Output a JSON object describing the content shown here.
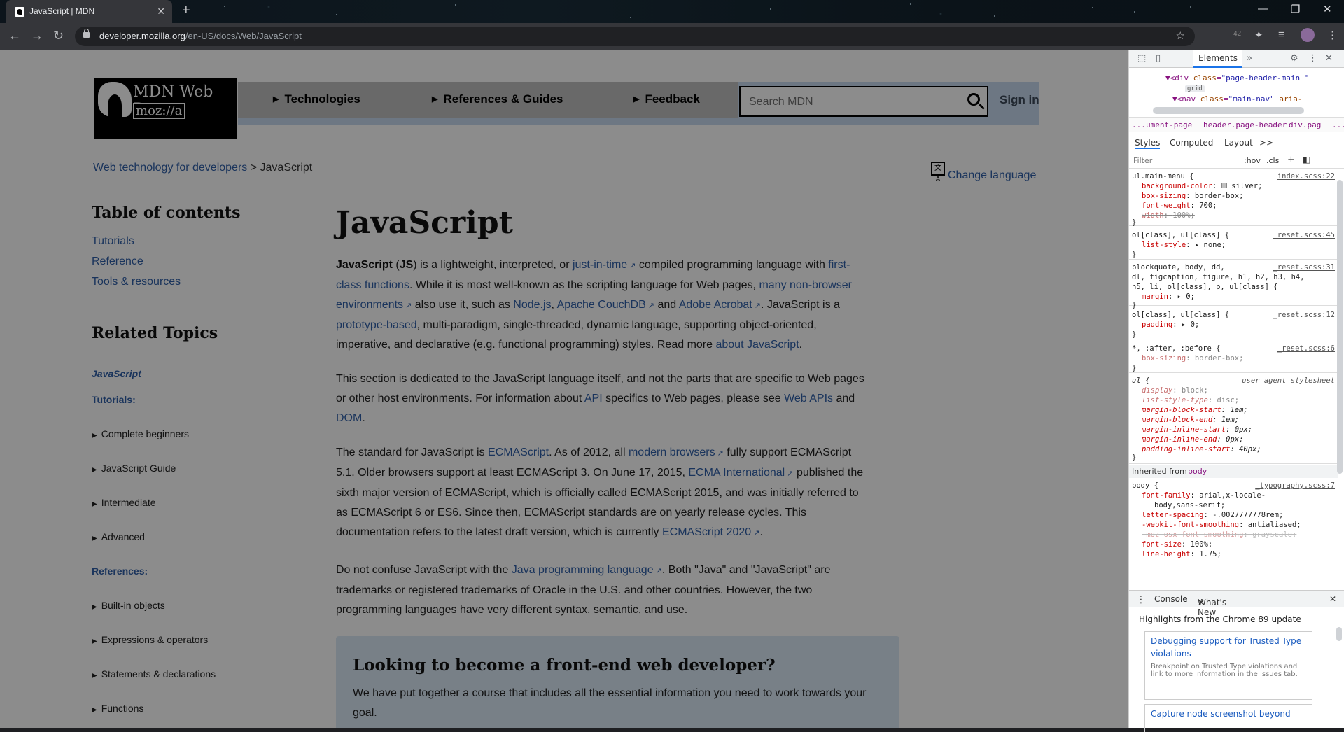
{
  "browser": {
    "tab_title": "JavaScript | MDN",
    "url_host": "developer.mozilla.org",
    "url_path": "/en-US/docs/Web/JavaScript",
    "extension_badge": "42"
  },
  "header": {
    "logo_line1": "MDN Web Docs",
    "logo_line2": "moz://a",
    "nav": [
      "Technologies",
      "References & Guides",
      "Feedback"
    ],
    "search_placeholder": "Search MDN",
    "sign_in": "Sign in"
  },
  "breadcrumb": {
    "parent": "Web technology for developers",
    "separator": ">",
    "current": "JavaScript"
  },
  "change_language": "Change language",
  "toc": {
    "title": "Table of contents",
    "links": [
      "Tutorials",
      "Reference",
      "Tools & resources"
    ]
  },
  "related": {
    "title": "Related Topics",
    "javascript": "JavaScript",
    "tutorials_heading": "Tutorials:",
    "tutorials": [
      "Complete beginners",
      "JavaScript Guide",
      "Intermediate",
      "Advanced"
    ],
    "references_heading": "References:",
    "references": [
      "Built-in objects",
      "Expressions & operators",
      "Statements & declarations",
      "Functions"
    ]
  },
  "article": {
    "title": "JavaScript",
    "p1": {
      "a": "JavaScript",
      "b": " (",
      "c": "JS",
      "d": ") is a lightweight, interpreted, or ",
      "jit": "just-in-time",
      "e": " compiled programming language with ",
      "fcf": "first-class functions",
      "f": ". While it is most well-known as the scripting language for Web pages, ",
      "nbe": "many non-browser environments",
      "g": " also use it, such as ",
      "node": "Node.js",
      "h": ", ",
      "couch": "Apache CouchDB",
      "i": " and ",
      "acro": "Adobe Acrobat",
      "j": ". JavaScript is a ",
      "proto": "prototype-based",
      "k": ", multi-paradigm, single-threaded, dynamic language, supporting object-oriented, imperative, and declarative (e.g. functional programming) styles. Read more ",
      "about": "about JavaScript",
      "l": "."
    },
    "p2": {
      "a": "This section is dedicated to the JavaScript language itself, and not the parts that are specific to Web pages or other host environments. For information about ",
      "api": "API",
      "b": " specifics to Web pages, please see ",
      "webapis": "Web APIs",
      "c": " and ",
      "dom": "DOM",
      "d": "."
    },
    "p3": {
      "a": "The standard for JavaScript is ",
      "ecma": "ECMAScript",
      "b": ". As of 2012, all ",
      "modern": "modern browsers",
      "c": " fully support ECMAScript 5.1. Older browsers support at least ECMAScript 3. On June 17, 2015, ",
      "ecmaint": "ECMA International",
      "d": " published the sixth major version of ECMAScript, which is officially called ECMAScript 2015, and was initially referred to as ECMAScript 6 or ES6. Since then, ECMAScript standards are on yearly release cycles. This documentation refers to the latest draft version, which is currently ",
      "ecma2020": "ECMAScript 2020",
      "e": "."
    },
    "p4": {
      "a": "Do not confuse JavaScript with the ",
      "java": "Java programming language",
      "b": ". Both \"Java\" and \"JavaScript\" are trademarks or registered trademarks of Oracle in the U.S. and other countries. However, the two programming languages have very different syntax, semantic, and use."
    },
    "callout_title": "Looking to become a front-end web developer?",
    "callout_text": "We have put together a course that includes all the essential information you need to work towards your goal."
  },
  "devtools": {
    "tab_elements": "Elements",
    "dom_line1_tag": "<div",
    "dom_line1_attr": "class",
    "dom_line1_val": "\"page-header-main \"",
    "dom_grid_badge": "grid",
    "dom_line2_tag": "<nav",
    "dom_line2_attr": "class",
    "dom_line2_val": "\"main-nav\"",
    "dom_line2_rest": "aria-",
    "crumbs": [
      "...",
      "ument-page",
      "header.page-header",
      "div.pag",
      "..."
    ],
    "subtabs": [
      "Styles",
      "Computed",
      "Layout",
      ">>"
    ],
    "filter_placeholder": "Filter",
    "filter_hov": ":hov",
    "filter_cls": ".cls",
    "rules": [
      {
        "selector": "ul.main-menu {",
        "source": "index.scss:22",
        "props": [
          [
            "background-color",
            "silver;"
          ],
          [
            "box-sizing",
            "border-box;"
          ],
          [
            "font-weight",
            "700;"
          ],
          [
            "width",
            "100%;"
          ]
        ]
      },
      {
        "selector": "ol[class], ul[class] {",
        "source": "_reset.scss:45",
        "props": [
          [
            "list-style",
            "none;"
          ]
        ]
      },
      {
        "selector": "blockquote, body, dd,",
        "selector2": "dl, figcaption, figure, h1, h2, h3, h4,",
        "selector3": "h5, li, ol[class], p, ul[class] {",
        "source": "_reset.scss:31",
        "props": [
          [
            "margin",
            "0;"
          ]
        ]
      },
      {
        "selector": "ol[class], ul[class] {",
        "source": "_reset.scss:12",
        "props": [
          [
            "padding",
            "0;"
          ]
        ]
      },
      {
        "selector": "*, :after, :before {",
        "source": "_reset.scss:6",
        "props": [
          [
            "box-sizing",
            "border-box;"
          ]
        ]
      },
      {
        "selector": "ul {",
        "source": "user agent stylesheet",
        "props": [
          [
            "display",
            "block;"
          ],
          [
            "list-style-type",
            "disc;"
          ],
          [
            "margin-block-start",
            "1em;"
          ],
          [
            "margin-block-end",
            "1em;"
          ],
          [
            "margin-inline-start",
            "0px;"
          ],
          [
            "margin-inline-end",
            "0px;"
          ],
          [
            "padding-inline-start",
            "40px;"
          ]
        ]
      }
    ],
    "inherited_label": "Inherited from",
    "inherited_from": "body",
    "body_rule": {
      "selector": "body {",
      "source": "_typography.scss:7",
      "props": [
        [
          "font-family",
          "arial,x-locale-"
        ],
        [
          "",
          "body,sans-serif;"
        ],
        [
          "letter-spacing",
          "-.0027777778rem;"
        ],
        [
          "-webkit-font-smoothing",
          "antialiased;"
        ],
        [
          "-moz-osx-font-smoothing",
          "grayscale;"
        ],
        [
          "font-size",
          "100%;"
        ],
        [
          "line-height",
          "1.75;"
        ]
      ]
    },
    "drawer_tabs": [
      "Console",
      "What's New"
    ],
    "highlights": "Highlights from the Chrome 89 update",
    "card1_title": "Debugging support for Trusted Type violations",
    "card1_desc": "Breakpoint on Trusted Type violations and link to more information in the Issues tab.",
    "card2_title": "Capture node screenshot beyond"
  }
}
